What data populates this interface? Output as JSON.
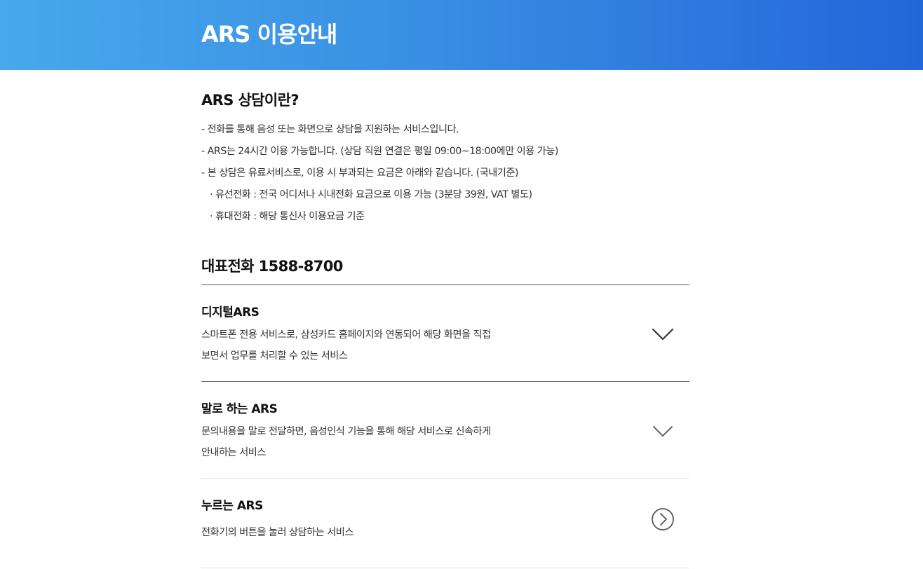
{
  "header": {
    "title": "ARS 이용안내"
  },
  "intro": {
    "title": "ARS 상담이란?",
    "lines": [
      "- 전화를 통해 음성 또는 화면으로 상담을 지원하는 서비스입니다.",
      "- ARS는 24시간 이용 가능합니다. (상담 직원 연결은 평일 09:00~18:00에만 이용 가능)",
      "- 본 상담은 유료서비스로, 이용 시 부과되는 요금은 아래와 같습니다. (국내기준)",
      "· 유선전화 : 전국 어디서나 시내전화 요금으로 이용 가능 (3분당 39원, VAT 별도)",
      "· 휴대전화 : 해당 통신사 이용요금 기준"
    ]
  },
  "phone": {
    "title": "대표전화 1588-8700"
  },
  "services": [
    {
      "title": "디지털ARS",
      "desc_line1": "스마트폰 전용 서비스로, 삼성카드 홈페이지와 연동되어 해당 화면을 직접",
      "desc_line2": "보면서 업무를 처리할 수 있는 서비스",
      "icon": "chevron-down-icon"
    },
    {
      "title": "말로 하는 ARS",
      "desc_line1": "문의내용을 말로 전달하면, 음성인식 기능을 통해 해당 서비스로 신속하게",
      "desc_line2": "안내하는 서비스",
      "icon": "chevron-down-icon"
    },
    {
      "title": "누르는 ARS",
      "desc_line1": "전화기의 버튼을 눌러 상담하는 서비스",
      "icon": "circle-chevron-right-icon"
    }
  ],
  "colors": {
    "header_gradient_start": "#47a9ec",
    "header_gradient_end": "#2366da",
    "text_dark": "#111111",
    "text_body": "#333333",
    "divider_strong": "#555555",
    "divider_light": "#e2e2e2"
  }
}
